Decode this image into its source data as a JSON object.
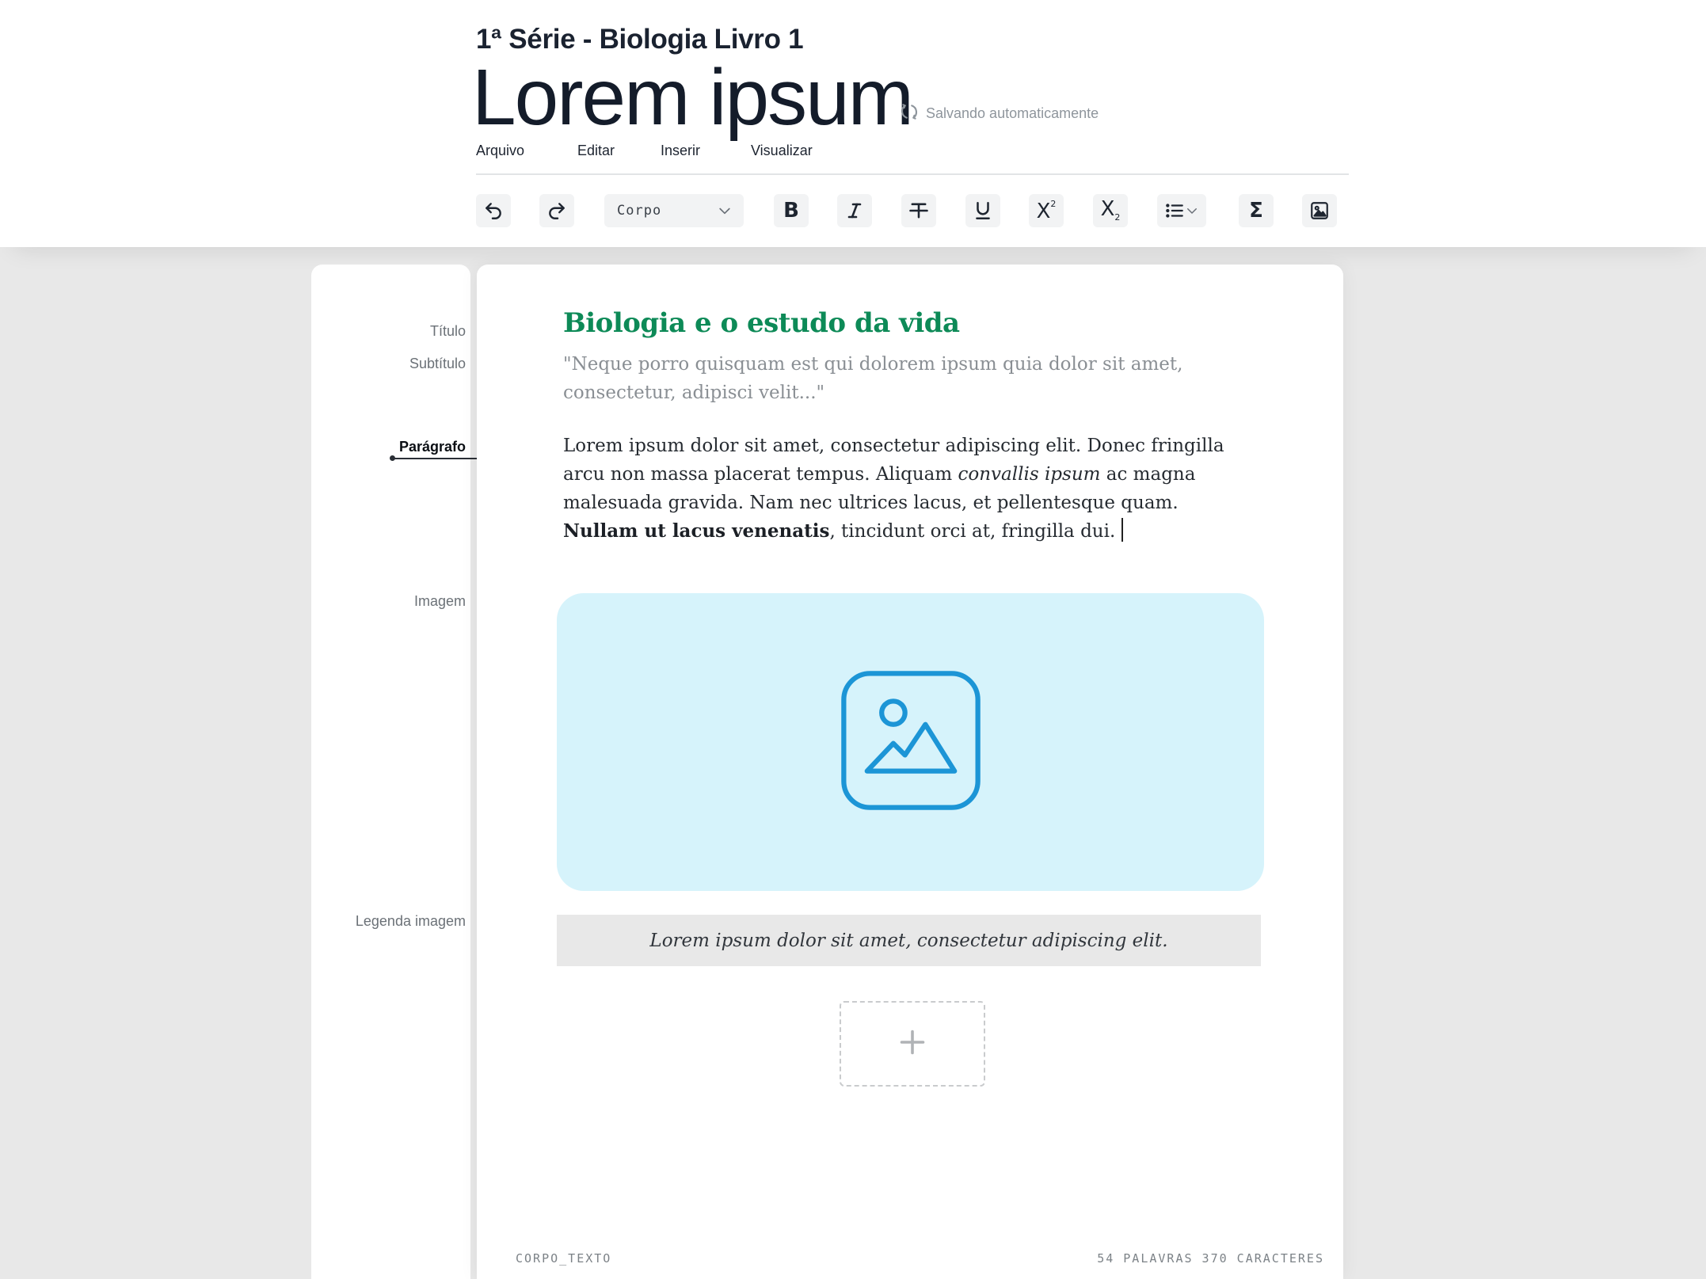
{
  "header": {
    "series": "1ª Série - Biologia  Livro 1",
    "title": "Lorem ipsum",
    "autosave": "Salvando automaticamente"
  },
  "menu": [
    "Arquivo",
    "Editar",
    "Inserir",
    "Visualizar"
  ],
  "toolbar": {
    "style_select": "Corpo",
    "buttons": [
      "undo-icon",
      "redo-icon",
      "bold-icon",
      "italic-icon",
      "strikethrough-icon",
      "underline-icon",
      "superscript-icon",
      "subscript-icon",
      "list-icon",
      "sigma-icon",
      "image-icon"
    ]
  },
  "sidebar": {
    "title": "Título",
    "subtitle": "Subtítulo",
    "paragraph": "Parágrafo",
    "image": "Imagem",
    "caption": "Legenda imagem"
  },
  "content": {
    "title": "Biologia e o estudo da vida",
    "subtitle": "\"Neque porro quisquam est qui dolorem ipsum quia dolor sit amet, consectetur, adipisci velit...\"",
    "para_1": "Lorem ipsum dolor sit amet, consectetur adipiscing elit. Donec fringilla arcu non massa placerat tempus. Aliquam ",
    "para_italic": "convallis ipsum",
    "para_2": " ac magna malesuada gravida. Nam nec ultrices lacus, et pellentesque quam. ",
    "para_bold": "Nullam ut lacus venenatis",
    "para_3": ", tincidunt orci at, fringilla dui.",
    "caption": "Lorem ipsum dolor sit amet, consectetur adipiscing elit."
  },
  "footer": {
    "style": "CORPO_TEXTO",
    "counts": "54 PALAVRAS 370 CARACTERES"
  },
  "colors": {
    "accent_green": "#0d8a57",
    "image_bg": "#d6f3fb",
    "image_icon": "#1c95d6"
  }
}
